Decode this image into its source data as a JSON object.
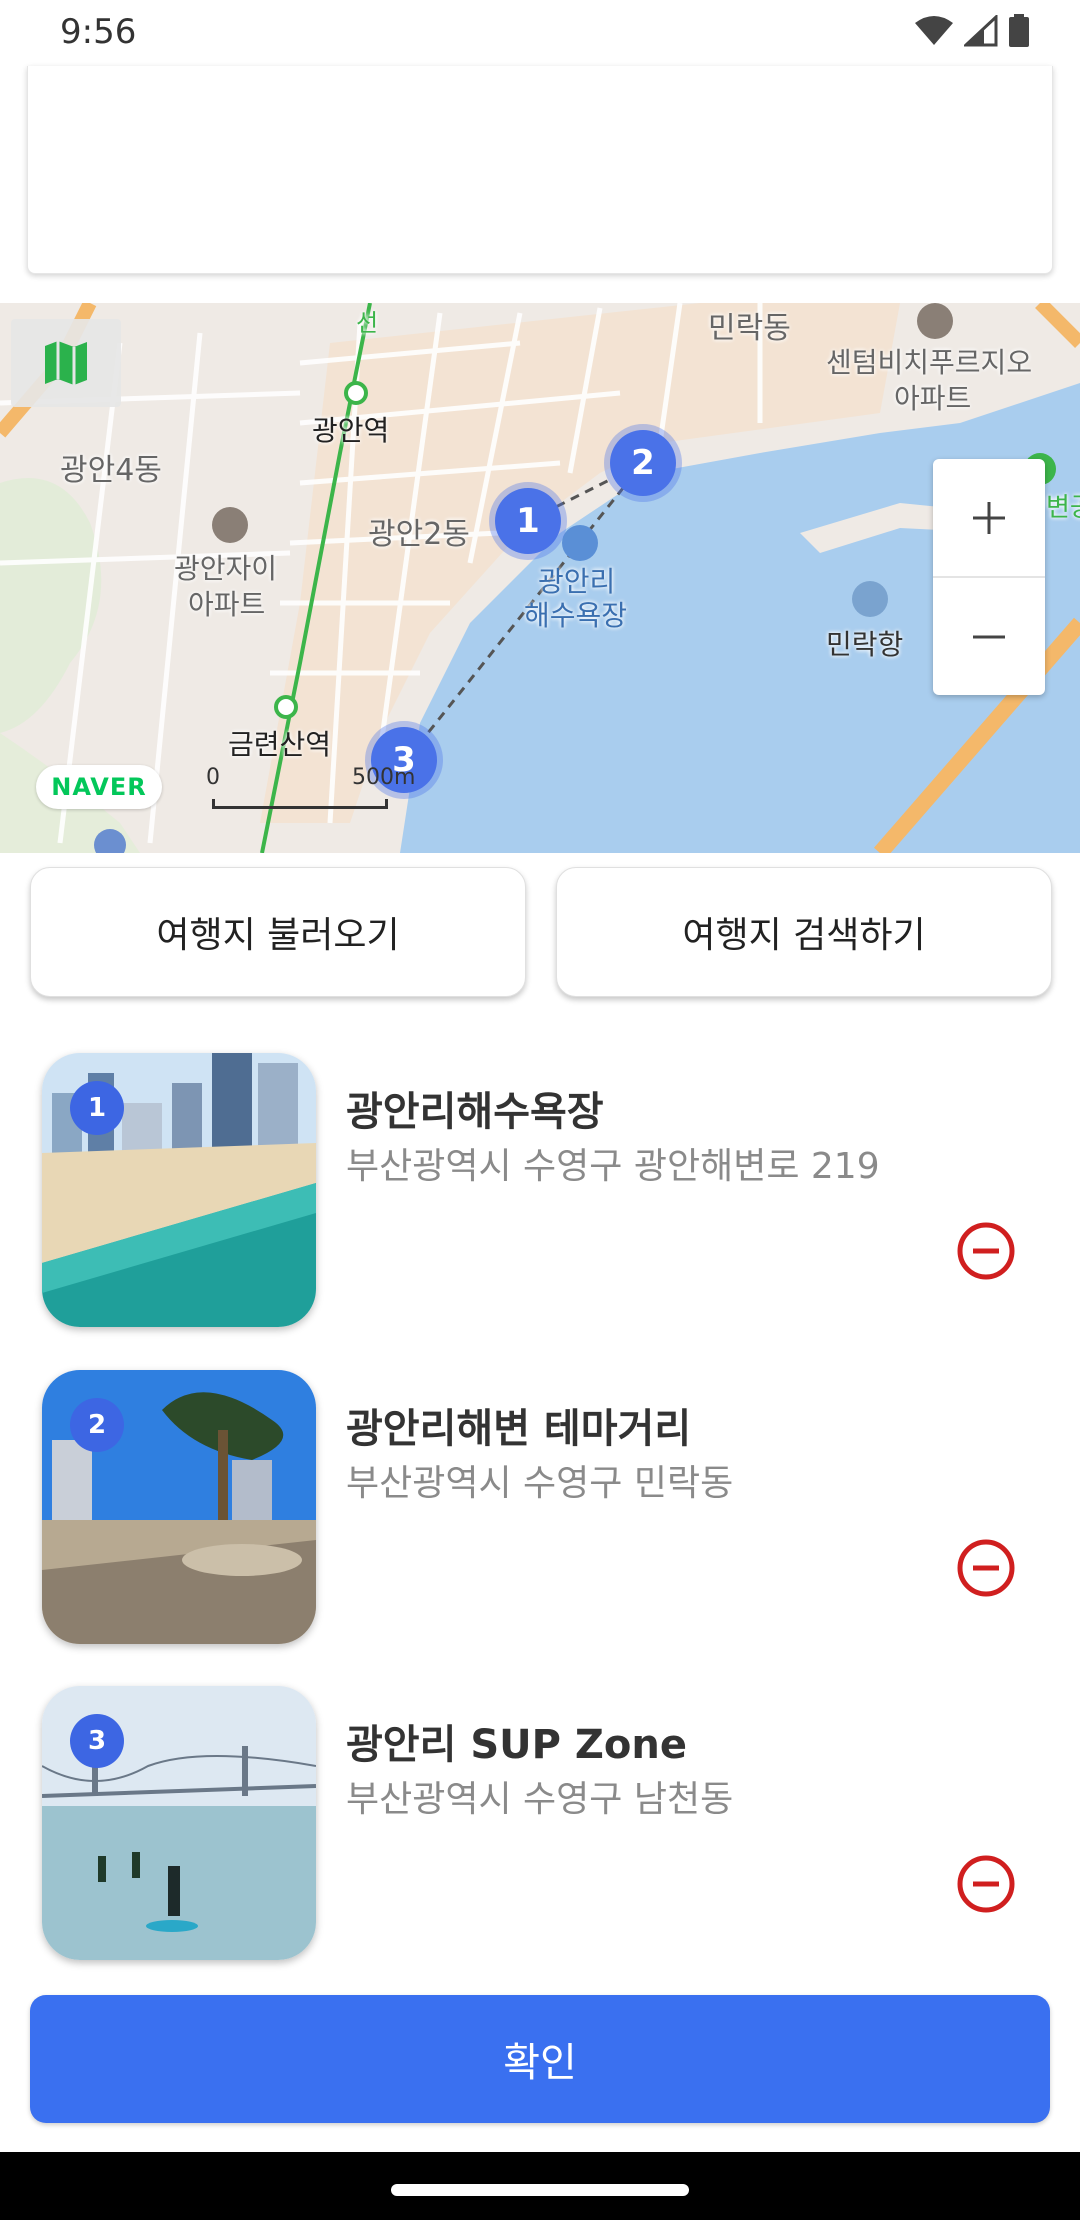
{
  "status_bar": {
    "time": "9:56",
    "icons": [
      "wifi-icon",
      "signal-icon",
      "battery-icon"
    ]
  },
  "map": {
    "labels": {
      "minrak_dong": "민락동",
      "centum_1": "센텀비치푸르지오",
      "centum_2": "아파트",
      "gwangan_station": "광안역",
      "gwangan4": "광안4동",
      "gwangan2": "광안2동",
      "gwangan_xi_1": "광안자이",
      "gwangan_xi_2": "아파트",
      "beach_1": "광안리",
      "beach_2": "해수욕장",
      "minrak_port": "민락항",
      "geumryeonsan": "금련산역",
      "line_label": "선",
      "edge_label": "변공"
    },
    "naver_logo": "NAVER",
    "scale": {
      "zero": "0",
      "distance": "500m"
    },
    "markers": [
      "1",
      "2",
      "3"
    ],
    "zoom_in": "+",
    "zoom_out": "−"
  },
  "actions": {
    "load": "여행지 불러오기",
    "search": "여행지 검색하기"
  },
  "places": [
    {
      "number": "1",
      "name": "광안리해수욕장",
      "address": "부산광역시 수영구 광안해변로 219"
    },
    {
      "number": "2",
      "name": "광안리해변 테마거리",
      "address": "부산광역시 수영구 민락동"
    },
    {
      "number": "3",
      "name": "광안리 SUP Zone",
      "address": "부산광역시 수영구 남천동"
    }
  ],
  "confirm": "확인",
  "colors": {
    "primary": "#3a70f0",
    "marker": "#4a72e8",
    "remove": "#d01f1f",
    "water": "#a9cdee"
  }
}
